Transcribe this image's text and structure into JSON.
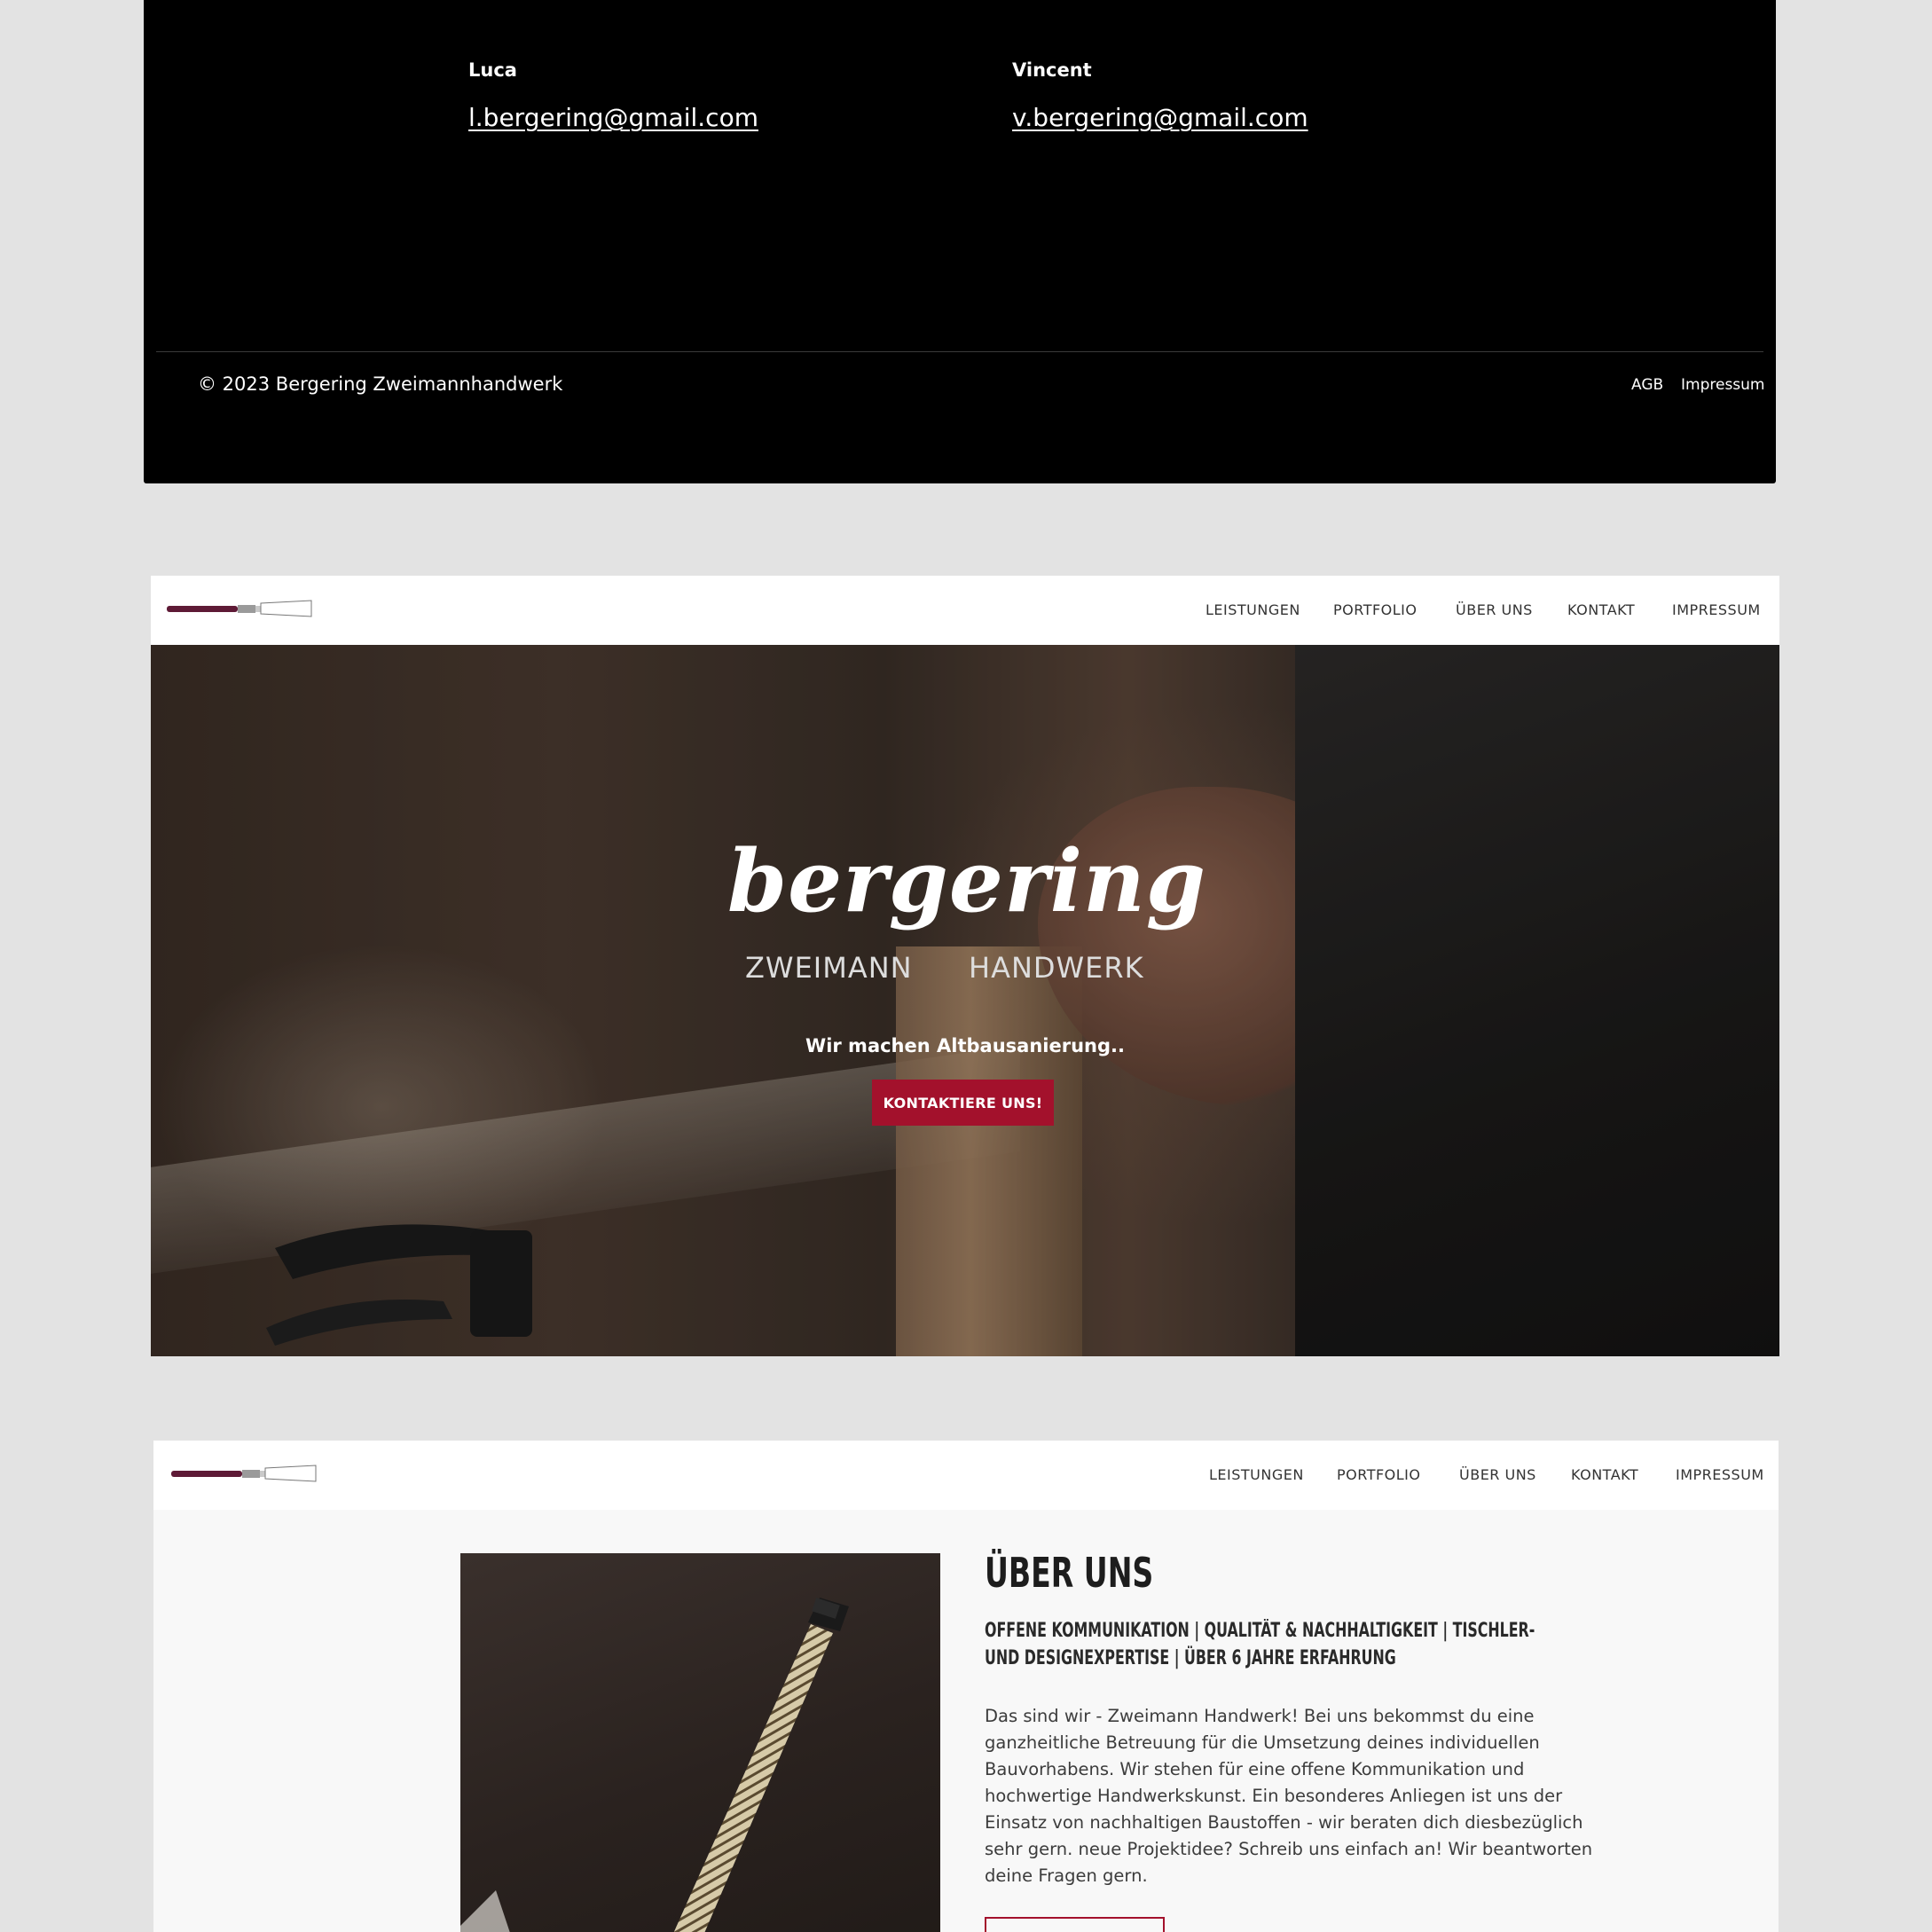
{
  "footer": {
    "contacts": [
      {
        "name": "Luca",
        "email": "l.bergering@gmail.com"
      },
      {
        "name": "Vincent",
        "email": "v.bergering@gmail.com"
      }
    ],
    "copyright": "© 2023 Bergering Zweimannhandwerk",
    "links": [
      "AGB",
      "Impressum"
    ]
  },
  "nav": {
    "items": [
      "LEISTUNGEN",
      "PORTFOLIO",
      "ÜBER UNS",
      "KONTAKT",
      "IMPRESSUM"
    ]
  },
  "hero": {
    "brand_word": "bergering",
    "brand_sub_left": "ZWEIMANN",
    "brand_sub_right": "HANDWERK",
    "tagline": "Wir machen Altbausanierung..",
    "cta_label": "KONTAKTIERE UNS!"
  },
  "about": {
    "title": "ÜBER UNS",
    "subtitle": "OFFENE KOMMUNIKATION | QUALITÄT & NACHHALTIGKEIT | TISCHLER- UND DESIGNEXPERTISE | ÜBER 6 JAHRE ERFAHRUNG",
    "body": "Das sind wir - Zweimann Handwerk! Bei uns bekommst du eine ganzheitliche Betreuung für die Umsetzung deines individuellen Bauvorhabens. Wir stehen für eine offene Kommunikation und hochwertige Handwerkskunst. Ein besonderes Anliegen ist uns der Einsatz von nachhaltigen Baustoffen - wir beraten dich diesbezüglich sehr gern. neue Projektidee? Schreib uns einfach an! Wir beantworten deine Fragen gern."
  },
  "colors": {
    "accent": "#a3112c",
    "footer_bg": "#000000",
    "page_bg": "#e3e3e3",
    "about_bg": "#f8f8f8"
  },
  "icons": {
    "logo": "chisel-logo-icon"
  }
}
